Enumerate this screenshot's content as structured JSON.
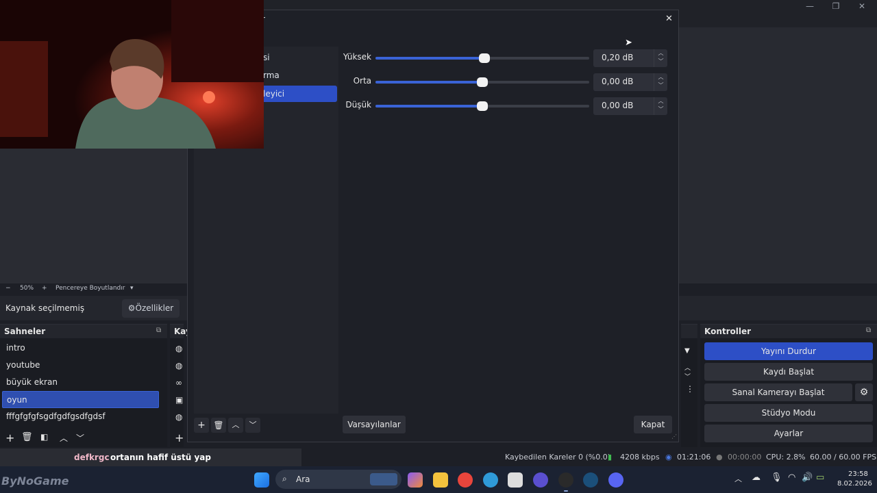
{
  "window": {
    "minimize": "—",
    "maximize": "❐",
    "close": "✕"
  },
  "zoom_bar": {
    "minus": "−",
    "zoom": "50%",
    "plus": "+",
    "resize_label": "Pencereye Boyutlandır",
    "dropdown": "▾"
  },
  "source_bar": {
    "status": "Kaynak seçilmemiş",
    "properties_label": "Özellikler"
  },
  "scenes": {
    "title": "Sahneler",
    "items": [
      "intro",
      "youtube",
      "büyük ekran",
      "oyun",
      "fffgfgfgfsgdfgdfgsdfgdsf"
    ],
    "selected_index": 3
  },
  "sources": {
    "title": "Kay"
  },
  "controls": {
    "title": "Kontroller",
    "buttons": [
      "Yayını Durdur",
      "Kaydı Başlat",
      "Sanal Kamerayı Başlat",
      "Stüdyo Modu",
      "Ayarlar"
    ]
  },
  "dialog": {
    "title_fragment": "r",
    "close": "✕",
    "filter_list": [
      "si",
      "rma",
      "leyici"
    ],
    "selected_filter_index": 2,
    "eq": [
      {
        "label": "Yüksek",
        "value": "0,20 dB",
        "level": 0.51
      },
      {
        "label": "Orta",
        "value": "0,00 dB",
        "level": 0.5
      },
      {
        "label": "Düşük",
        "value": "0,00 dB",
        "level": 0.5
      }
    ],
    "defaults_button": "Varsayılanlar",
    "close_button": "Kapat"
  },
  "chat": {
    "user": "defkrgc",
    "message": "ortanın hafif üstü yap"
  },
  "status": {
    "dropped": "Kaybedilen Kareler 0 (%0.0)",
    "bitrate": "4208 kbps",
    "stream_time": "01:21:06",
    "rec_time": "00:00:00",
    "cpu": "CPU: 2.8%",
    "fps": "60.00 / 60.00 FPS"
  },
  "watermark": "ByNoGame",
  "taskbar": {
    "search_label": "Ara",
    "time": "23:58",
    "date": "8.02.2026"
  },
  "colors": {
    "accent": "#2d4fc6",
    "panel": "#1a1c22",
    "dialog": "#1e2027"
  }
}
